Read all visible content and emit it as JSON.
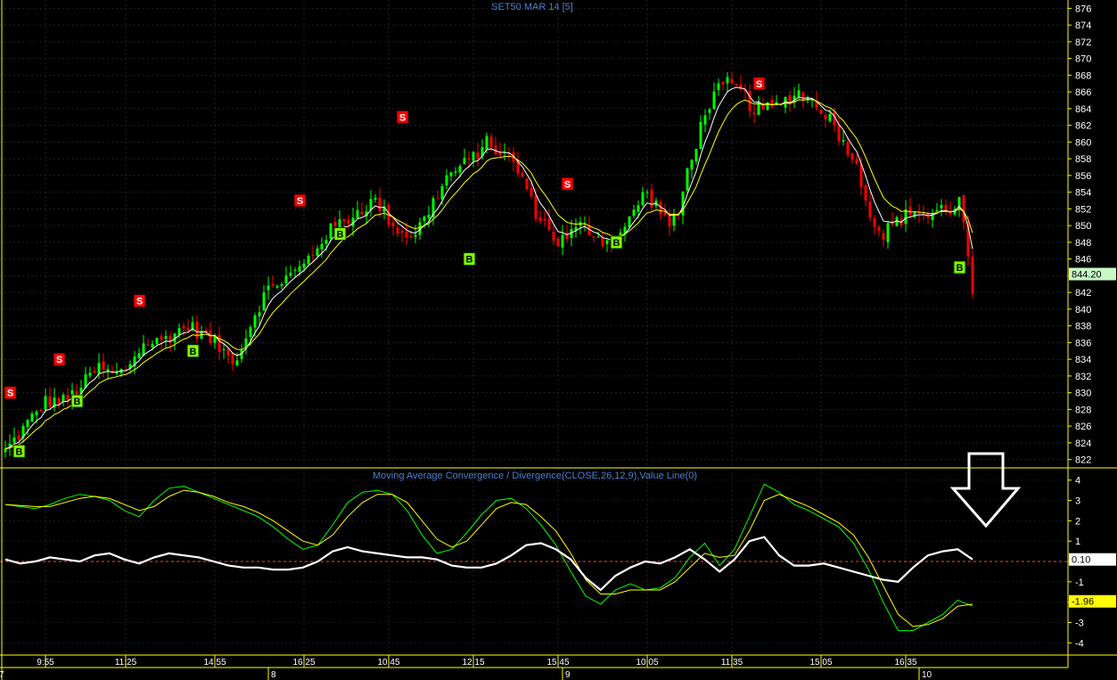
{
  "chart_data": [
    {
      "panel": "price",
      "type": "candlestick",
      "title": "SET50 MAR 14   [5]",
      "y_ticks": [
        822,
        824,
        826,
        828,
        830,
        832,
        834,
        836,
        838,
        840,
        842,
        844,
        846,
        848,
        850,
        852,
        854,
        856,
        858,
        860,
        862,
        864,
        866,
        868,
        870,
        872,
        874,
        876
      ],
      "ylim": [
        821,
        877
      ],
      "last_price_label": "844.20",
      "grid": true,
      "colors": {
        "up": "#00ff00",
        "down": "#ff0000",
        "ma_fast": "#ffffff",
        "ma_slow": "#ffff00",
        "buy_marker": "#80ff00",
        "sell_marker": "#ff0000",
        "grid": "#2a2a2a",
        "axis": "#ffff00"
      },
      "approx_close_path": [
        [
          0,
          823
        ],
        [
          10,
          826
        ],
        [
          20,
          829
        ],
        [
          30,
          829
        ],
        [
          38,
          831
        ],
        [
          46,
          833
        ],
        [
          54,
          832
        ],
        [
          60,
          833
        ],
        [
          65,
          835
        ],
        [
          70,
          836
        ],
        [
          75,
          836
        ],
        [
          82,
          837
        ],
        [
          90,
          838
        ],
        [
          97,
          837
        ],
        [
          103,
          836
        ],
        [
          107,
          835
        ],
        [
          111,
          834
        ],
        [
          116,
          835
        ],
        [
          120,
          838
        ],
        [
          124,
          840
        ],
        [
          128,
          842
        ],
        [
          133,
          843
        ],
        [
          140,
          844
        ],
        [
          146,
          845
        ],
        [
          152,
          847
        ],
        [
          158,
          849
        ],
        [
          163,
          850
        ],
        [
          170,
          851
        ],
        [
          175,
          852
        ],
        [
          182,
          853
        ],
        [
          188,
          851
        ],
        [
          195,
          849
        ],
        [
          201,
          849
        ],
        [
          207,
          851
        ],
        [
          213,
          854
        ],
        [
          218,
          856
        ],
        [
          224,
          857
        ],
        [
          230,
          858
        ],
        [
          236,
          860
        ],
        [
          242,
          859
        ],
        [
          248,
          858
        ],
        [
          254,
          856
        ],
        [
          260,
          852
        ],
        [
          266,
          850
        ],
        [
          272,
          848
        ],
        [
          278,
          849
        ],
        [
          284,
          850
        ],
        [
          290,
          849
        ],
        [
          296,
          848
        ],
        [
          302,
          849
        ],
        [
          306,
          850
        ],
        [
          310,
          852
        ],
        [
          314,
          854
        ],
        [
          318,
          853
        ],
        [
          322,
          852
        ],
        [
          327,
          850
        ],
        [
          331,
          851
        ],
        [
          335,
          856
        ],
        [
          340,
          860
        ],
        [
          345,
          864
        ],
        [
          350,
          866
        ],
        [
          356,
          867
        ],
        [
          362,
          866
        ],
        [
          368,
          864
        ],
        [
          373,
          864
        ],
        [
          378,
          864
        ],
        [
          384,
          865
        ],
        [
          390,
          866
        ],
        [
          396,
          865
        ],
        [
          402,
          864
        ],
        [
          408,
          862
        ],
        [
          412,
          860
        ],
        [
          416,
          859
        ],
        [
          420,
          856
        ],
        [
          424,
          853
        ],
        [
          428,
          850
        ],
        [
          432,
          849
        ],
        [
          436,
          850
        ],
        [
          442,
          851
        ],
        [
          448,
          852
        ],
        [
          454,
          851
        ],
        [
          460,
          852
        ],
        [
          466,
          852
        ],
        [
          470,
          853
        ],
        [
          472,
          850
        ],
        [
          474,
          845
        ],
        [
          476,
          842
        ]
      ],
      "signals": [
        {
          "type": "S",
          "bar": 1,
          "price": 830
        },
        {
          "type": "B",
          "bar": 3,
          "price": 823
        },
        {
          "type": "S",
          "bar": 12,
          "price": 834
        },
        {
          "type": "B",
          "bar": 16,
          "price": 829
        },
        {
          "type": "S",
          "bar": 30,
          "price": 841
        },
        {
          "type": "B",
          "bar": 42,
          "price": 835
        },
        {
          "type": "S",
          "bar": 66,
          "price": 853
        },
        {
          "type": "B",
          "bar": 75,
          "price": 849
        },
        {
          "type": "S",
          "bar": 89,
          "price": 863
        },
        {
          "type": "B",
          "bar": 104,
          "price": 846
        },
        {
          "type": "S",
          "bar": 126,
          "price": 855
        },
        {
          "type": "B",
          "bar": 137,
          "price": 848
        },
        {
          "type": "S",
          "bar": 169,
          "price": 867
        },
        {
          "type": "B",
          "bar": 214,
          "price": 845
        }
      ]
    },
    {
      "panel": "indicator",
      "type": "line",
      "title": "Moving Average Convergence / Divergence(CLOSE,26,12,9),Value Line(0)",
      "y_ticks": [
        4,
        3,
        2,
        1,
        0,
        -1,
        -2,
        -3,
        -4
      ],
      "y_tick_labels": [
        "4",
        "3",
        "2",
        "1",
        "",
        "-1",
        "",
        "-3",
        "-4"
      ],
      "ylim": [
        -4.6,
        4.6
      ],
      "value_labels": [
        {
          "text": "0.10",
          "value": 0.1
        },
        {
          "text": "-1.96",
          "value": -1.96
        }
      ],
      "zero_line_color": "#ff4040",
      "series": [
        {
          "color": "#00ff00",
          "values": [
            2.8,
            2.7,
            2.6,
            2.8,
            3.1,
            3.3,
            3.2,
            3.0,
            2.5,
            2.2,
            3.0,
            3.6,
            3.7,
            3.4,
            3.1,
            2.8,
            2.5,
            2.2,
            1.7,
            1.1,
            0.6,
            0.8,
            1.8,
            2.9,
            3.4,
            3.5,
            3.3,
            2.5,
            1.3,
            0.4,
            0.6,
            1.4,
            2.3,
            3.0,
            3.1,
            2.6,
            1.8,
            0.8,
            -0.5,
            -1.7,
            -2.1,
            -1.4,
            -1.1,
            -1.4,
            -1.3,
            -0.8,
            0.2,
            0.9,
            -0.2,
            0.6,
            2.2,
            3.8,
            3.4,
            2.8,
            2.5,
            2.1,
            1.7,
            0.9,
            -0.4,
            -2.0,
            -3.4,
            -3.4,
            -3.0,
            -2.6,
            -1.9,
            -2.2
          ]
        },
        {
          "color": "#ffff00",
          "values": [
            2.8,
            2.75,
            2.7,
            2.7,
            2.9,
            3.1,
            3.2,
            3.1,
            2.8,
            2.5,
            2.7,
            3.2,
            3.5,
            3.4,
            3.2,
            2.9,
            2.7,
            2.4,
            2.0,
            1.5,
            1.0,
            0.8,
            1.3,
            2.2,
            2.9,
            3.3,
            3.3,
            2.9,
            2.0,
            1.1,
            0.7,
            1.0,
            1.8,
            2.6,
            2.9,
            2.8,
            2.2,
            1.5,
            0.4,
            -0.9,
            -1.6,
            -1.6,
            -1.4,
            -1.4,
            -1.4,
            -1.0,
            -0.3,
            0.4,
            0.2,
            0.3,
            1.5,
            3.0,
            3.3,
            3.0,
            2.7,
            2.3,
            1.9,
            1.3,
            0.2,
            -1.2,
            -2.6,
            -3.2,
            -3.1,
            -2.8,
            -2.2,
            -2.1
          ]
        },
        {
          "color": "#ffffff",
          "values": [
            0.1,
            -0.1,
            0.0,
            0.2,
            0.1,
            0.0,
            0.3,
            0.4,
            0.1,
            -0.1,
            0.2,
            0.4,
            0.3,
            0.2,
            0.0,
            -0.2,
            -0.3,
            -0.3,
            -0.4,
            -0.4,
            -0.3,
            0.0,
            0.5,
            0.7,
            0.5,
            0.4,
            0.3,
            0.2,
            0.2,
            0.1,
            -0.2,
            -0.3,
            -0.3,
            -0.1,
            0.3,
            0.8,
            0.9,
            0.6,
            0.1,
            -0.8,
            -1.4,
            -0.7,
            -0.3,
            0.0,
            -0.1,
            0.2,
            0.6,
            0.1,
            -0.5,
            0.1,
            1.0,
            1.2,
            0.3,
            -0.2,
            -0.2,
            -0.1,
            -0.3,
            -0.5,
            -0.7,
            -0.9,
            -1.0,
            -0.3,
            0.3,
            0.5,
            0.6,
            0.1
          ]
        }
      ]
    }
  ],
  "x_axis": {
    "time_labels": [
      {
        "label": "9:55",
        "bar": 9
      },
      {
        "label": "11:25",
        "bar": 27
      },
      {
        "label": "14:55",
        "bar": 47
      },
      {
        "label": "16:25",
        "bar": 67
      },
      {
        "label": "10:45",
        "bar": 86
      },
      {
        "label": "12:15",
        "bar": 105
      },
      {
        "label": "15:45",
        "bar": 124
      },
      {
        "label": "10:05",
        "bar": 144
      },
      {
        "label": "11:35",
        "bar": 163
      },
      {
        "label": "15:05",
        "bar": 183
      },
      {
        "label": "16:35",
        "bar": 202
      }
    ],
    "day_labels": [
      {
        "label": "7",
        "bar": 0
      },
      {
        "label": "8",
        "bar": 61
      },
      {
        "label": "9",
        "bar": 127
      },
      {
        "label": "10",
        "bar": 207
      }
    ],
    "total_bars": 218
  },
  "annotation": {
    "type": "down-arrow",
    "color": "#ffffff"
  }
}
